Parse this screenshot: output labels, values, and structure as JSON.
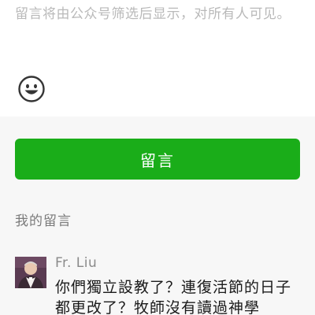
{
  "compose": {
    "placeholder": "留言将由公众号筛选后显示，对所有人可见。",
    "emoji_icon": "smiley-face-icon"
  },
  "submit_button": {
    "label": "留言"
  },
  "my_comments": {
    "title": "我的留言",
    "items": [
      {
        "author": "Fr. Liu",
        "avatar_icon": "user-avatar-photo",
        "text": "你們獨立設教了？連復活節的日子都更改了？牧師沒有讀過神學"
      }
    ]
  },
  "colors": {
    "accent": "#1aad19",
    "placeholder": "#b9b9b9",
    "section_bg": "#f7f7f7",
    "muted_text": "#7b7b7b"
  }
}
